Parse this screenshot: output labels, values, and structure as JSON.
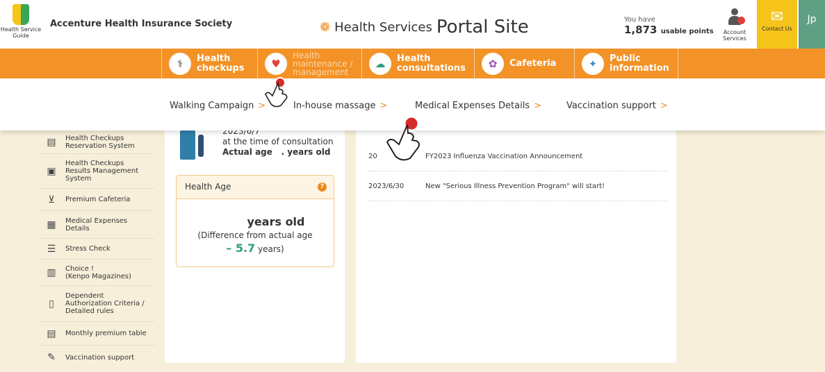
{
  "header": {
    "guide_label": "Health Service\nGuide",
    "society_name": "Accenture Health Insurance Society",
    "portal_prefix": "Health Services",
    "portal_main": "Portal Site",
    "points_line1": "You have",
    "points_value": "1,873",
    "points_suffix": "usable points",
    "account_label": "Account\nServices",
    "contact_label": "Contact Us",
    "language": "Jp"
  },
  "nav": {
    "items": [
      {
        "label": "Health\ncheckups",
        "icon": "stethoscope-icon"
      },
      {
        "label": "Health\nmaintenance /\nmanagement",
        "icon": "heart-icon"
      },
      {
        "label": "Health\nconsultations",
        "icon": "chat-bubbles-icon"
      },
      {
        "label": "Cafeteria",
        "icon": "gift-icon"
      },
      {
        "label": "Public\ninformation",
        "icon": "megaphone-icon"
      }
    ]
  },
  "submenu": {
    "items": [
      "Walking Campaign",
      "In-house massage",
      "Medical Expenses Details",
      "Vaccination support"
    ],
    "arrow": ">"
  },
  "sidebar": {
    "items": [
      {
        "label": "Health Checkups\nReservation System",
        "icon": "calendar-icon"
      },
      {
        "label": "Health Checkups\nResults Management\nSystem",
        "icon": "clipboard-icon"
      },
      {
        "label": "Premium Cafeteria",
        "icon": "cart-icon"
      },
      {
        "label": "Medical Expenses\nDetails",
        "icon": "calculator-icon"
      },
      {
        "label": "Stress Check",
        "icon": "checklist-icon"
      },
      {
        "label": "Choice !\n(Kenpo Magazines)",
        "icon": "magazine-icon"
      },
      {
        "label": "Dependent\nAuthorization Criteria /\nDetailed rules",
        "icon": "document-icon"
      },
      {
        "label": "Monthly premium table",
        "icon": "table-icon"
      },
      {
        "label": "Vaccination support",
        "icon": "syringe-icon"
      }
    ]
  },
  "age_card": {
    "date": "2023/6/7",
    "consult_text": "at the time of consultation",
    "actual_age_label": "Actual age",
    "actual_age_suffix": ". years old",
    "health_age_title": "Health Age",
    "help_symbol": "?",
    "years_old": "years old",
    "difference_label": "(Difference from actual age",
    "difference_value": "– 5.7",
    "difference_unit": "years)"
  },
  "news": {
    "items": [
      {
        "date": "20",
        "title": "FY2023 Influenza Vaccination Announcement"
      },
      {
        "date": "2023/6/30",
        "title": "New \"Serious Illness Prevention Program\" will start!"
      }
    ]
  },
  "colors": {
    "nav_orange": "#f39226",
    "contact_yellow": "#f6c31b",
    "lang_green": "#5fa084",
    "background": "#f7efd9",
    "accent_teal": "#2a9d80"
  }
}
